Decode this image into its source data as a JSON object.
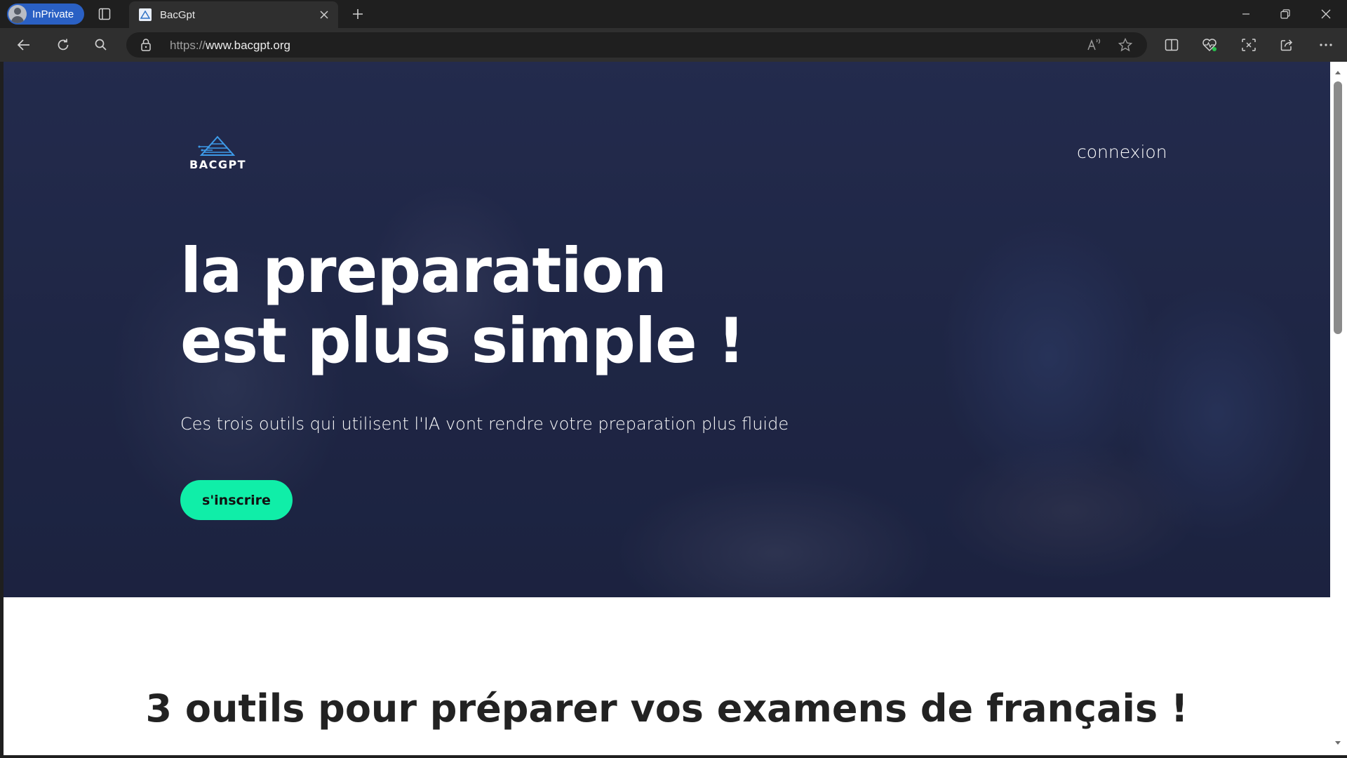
{
  "browser": {
    "profile_label": "InPrivate",
    "tab_title": "BacGpt",
    "url_prefix": "https://",
    "url_domain": "www.bacgpt.org",
    "accent_color": "#2a60c4"
  },
  "page": {
    "logo_text": "BACGPT",
    "nav_login": "connexion",
    "headline_line1": "la preparation",
    "headline_line2": "est plus simple !",
    "subheadline": "Ces trois outils qui utilisent l'IA vont rendre votre preparation plus fluide",
    "cta_label": "s'inscrire",
    "cta_color": "#10eea8",
    "section_title": "3 outils pour préparer vos examens de français !"
  },
  "icons": [
    "inprivate-avatar-icon",
    "tab-actions-icon",
    "page-favicon",
    "close-icon",
    "plus-icon",
    "minimize-icon",
    "restore-icon",
    "window-close-icon",
    "back-icon",
    "refresh-icon",
    "search-icon",
    "lock-icon",
    "read-aloud-icon",
    "favorite-star-icon",
    "split-screen-icon",
    "browser-essentials-icon",
    "screenshot-icon",
    "share-icon",
    "more-icon"
  ]
}
